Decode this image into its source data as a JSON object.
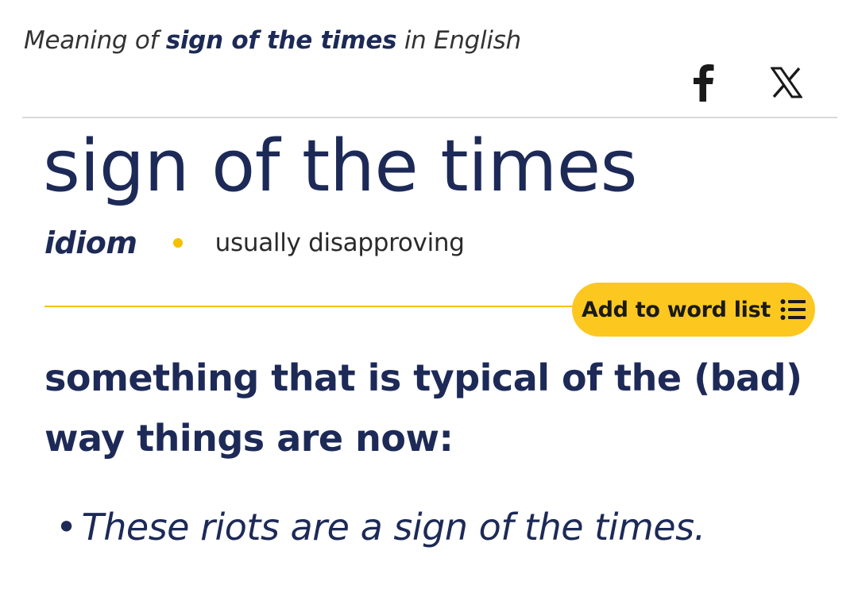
{
  "header": {
    "prefix": "Meaning of",
    "term": "sign of the times",
    "suffix": "in English"
  },
  "share": {
    "icons": [
      "facebook-icon",
      "x-icon"
    ]
  },
  "entry": {
    "headword": "sign of the times",
    "part_of_speech": "idiom",
    "usage_label": "usually disapproving",
    "add_to_word_list_label": "Add to word list",
    "definition": "something that is typical of the (bad) way things are now:",
    "examples": [
      "These riots are a sign of the times."
    ]
  },
  "colors": {
    "headword": "#1d2a57",
    "accent_yellow": "#fcc820",
    "divider": "#d9d9d9"
  }
}
